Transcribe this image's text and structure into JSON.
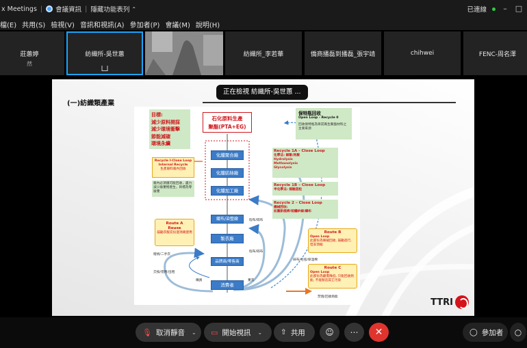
{
  "titlebar": {
    "app_name": "x Meetings",
    "meeting_info": "會議資訊",
    "hide_features": "隱藏功能表列",
    "connection": "已連線"
  },
  "menu": [
    "檔(E)",
    "共用(S)",
    "檢視(V)",
    "音訊和視訊(A)",
    "參加者(P)",
    "會議(M)",
    "說明(H)"
  ],
  "participants": [
    {
      "name": "莊蕙婷",
      "sub": "然"
    },
    {
      "name": "紡織所-吳世蕙",
      "sharing": true
    },
    {
      "name": ""
    },
    {
      "name": "紡織所_李若華"
    },
    {
      "name": "僑商播磊到播磊_張宇靖"
    },
    {
      "name": "chihwei"
    },
    {
      "name": "FENC-周名澤"
    }
  ],
  "viewing_banner": "正在檢視 紡織所-吳世蕙 ...",
  "slide": {
    "title": "(一)紡織類產業",
    "brand": "TTRI",
    "goals": [
      "目標:",
      "減少原料開採",
      "減少環境衝擊",
      "節能減碳",
      "環境永續"
    ],
    "top_box": [
      "石化原料生產",
      "聚酯(PTA+EG)"
    ],
    "bottle": {
      "title": "保特瓶回收",
      "sub": "Open Loop - Recycle 0",
      "desc": "回收保特瓶為目前再生聚酯材料之主要來源"
    },
    "chain": [
      "化纖聚合廠",
      "化纖紡絲廠",
      "化纖加工廠",
      "織布/染整廠",
      "製衣廠",
      "品牌商/零售商",
      "消費者"
    ],
    "recycle_i": {
      "title": "Recycle I-Close Loop",
      "sub": "Internal Recycle",
      "desc": "生產廢料廠內回收"
    },
    "internal_note": "廠內必須遵可能回收，盡力減少廢棄物產生，目標為零廢棄",
    "r1a": {
      "title": "Recycle 1A - Close Loop",
      "lines": [
        "化學法: 解聚/再聚",
        "Hydrolysis",
        "Methanolysis",
        "Glycolysis"
      ]
    },
    "r1b": {
      "title": "Recycle 1B – Close Loop",
      "lines": [
        "半化學法: 熔融造粒"
      ]
    },
    "r2": {
      "title": "Recycle 2 – Close Loop",
      "lines": [
        "機械回收:",
        "如重新梳棉/短纖紗線/織布"
      ]
    },
    "route_a": {
      "title": "Route A",
      "sub": "Reuse",
      "desc": "鼓勵衣服充份過項再使用"
    },
    "route_b": {
      "title": "Route B",
      "sub": "Open Loop",
      "desc": "此部份為降級回收, 鼓勵進行, 但非頂級"
    },
    "route_c": {
      "title": "Route C",
      "sub": "Open Loop",
      "desc": "此部份為最需降低, 只能回收熱能, 不能製造其它污染"
    },
    "labels": {
      "damaged": "瑕布/碎布",
      "secondhand": "贈捐/二手衣",
      "exchange": "交換/借用/出租",
      "buy": "購買",
      "discard": "棄衣",
      "rags": "抹布/毛毯/保溫棉",
      "incinerate": "焚燒/回收熱能"
    }
  },
  "toolbar": {
    "unmute": "取消靜音",
    "start_video": "開始視訊",
    "share": "共用",
    "participants": "參加者"
  },
  "colors": {
    "active_border": "#1aa5ff",
    "end_button": "#e0342e",
    "diagram_blue": "#3b7bc7",
    "alert_red": "#d1151b"
  }
}
